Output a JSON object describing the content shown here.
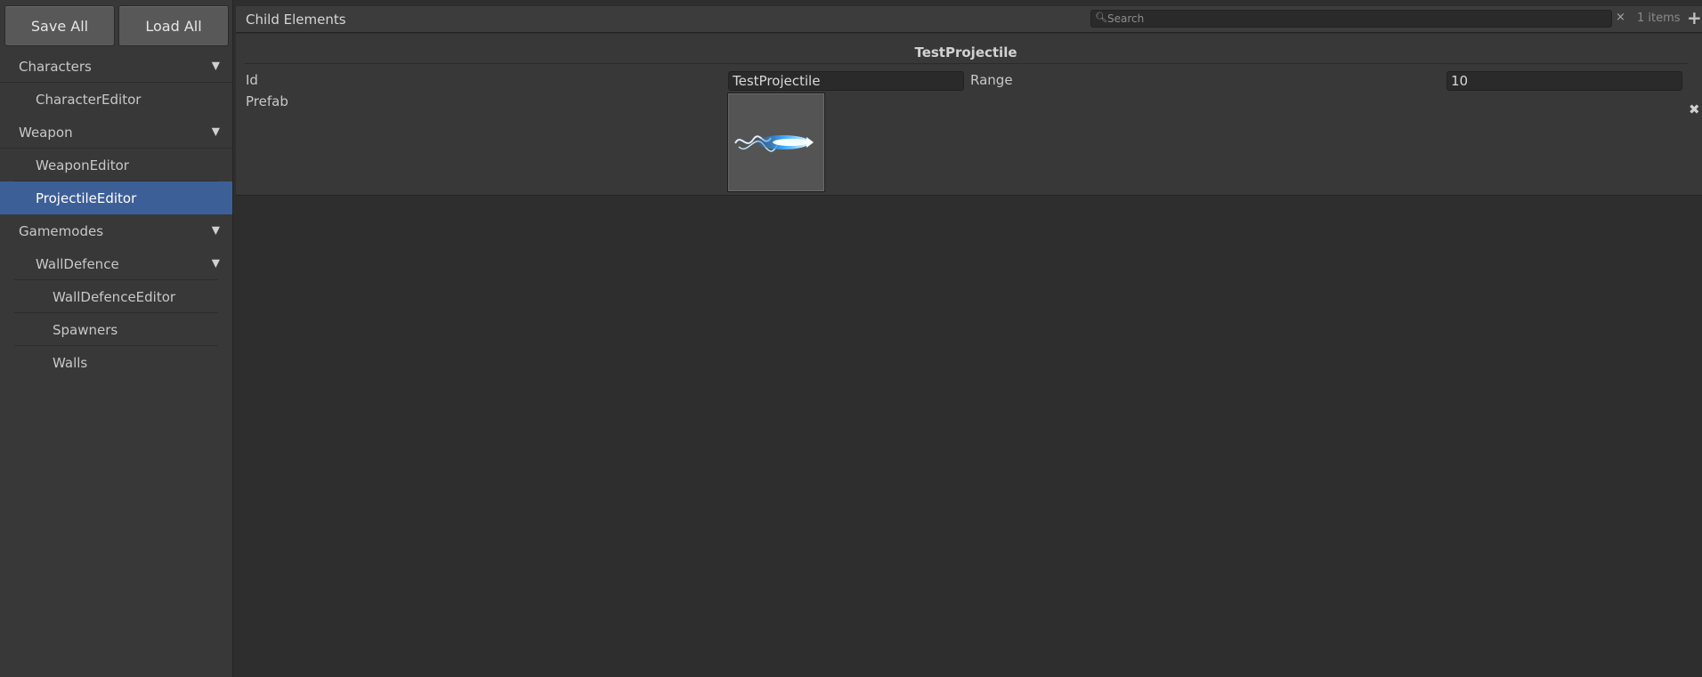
{
  "sidebar": {
    "save_label": "Save All",
    "load_label": "Load All",
    "items": [
      {
        "label": "Characters",
        "expandable": true
      },
      {
        "label": "CharacterEditor"
      },
      {
        "label": "Weapon",
        "expandable": true
      },
      {
        "label": "WeaponEditor"
      },
      {
        "label": "ProjectileEditor",
        "selected": true
      },
      {
        "label": "Gamemodes",
        "expandable": true
      },
      {
        "label": "WallDefence",
        "expandable": true
      },
      {
        "label": "WallDefenceEditor"
      },
      {
        "label": "Spawners"
      },
      {
        "label": "Walls"
      }
    ],
    "arrow_glyph": "▼"
  },
  "header": {
    "title": "Child Elements",
    "search_placeholder": "Search",
    "search_value": "",
    "clear_glyph": "×",
    "count_text": "1 items",
    "add_glyph": "+"
  },
  "element": {
    "title": "TestProjectile",
    "id_label": "Id",
    "id_value": "TestProjectile",
    "range_label": "Range",
    "range_value": "10",
    "prefab_label": "Prefab",
    "remove_glyph": "✖"
  },
  "colors": {
    "selection": "#3d5f98",
    "panel": "#383838",
    "background": "#2e2e2e",
    "projectile_glow": "#6fd0ff"
  }
}
